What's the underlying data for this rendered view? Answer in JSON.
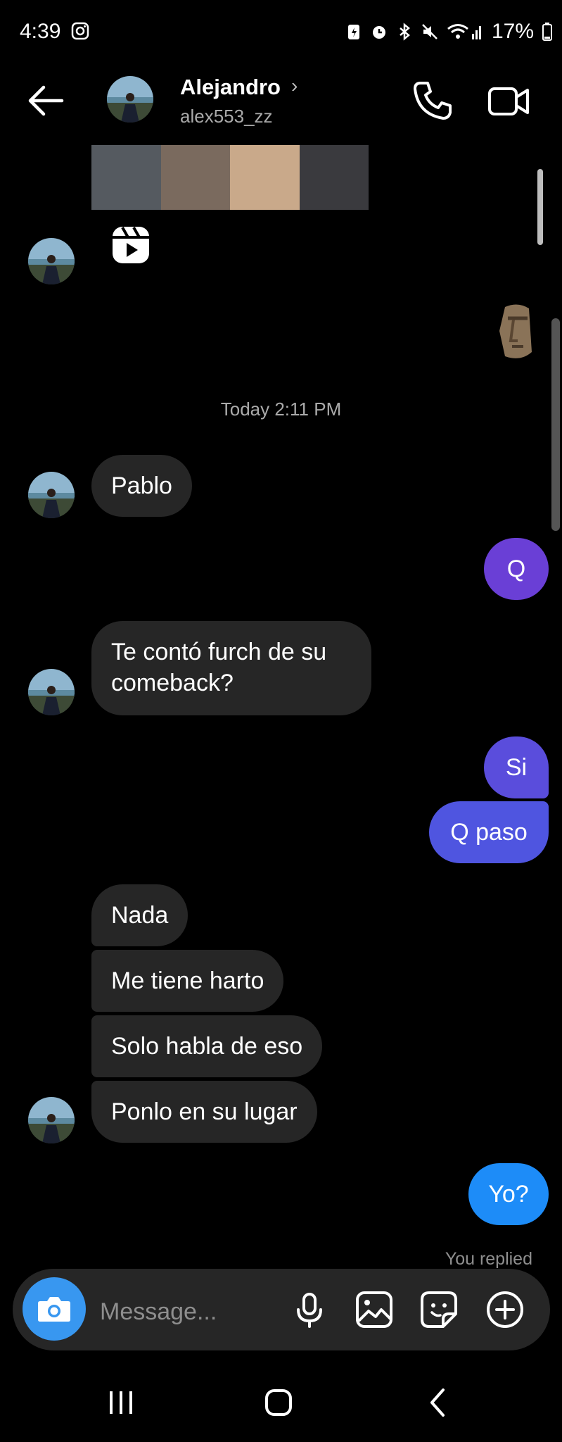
{
  "status_bar": {
    "time": "4:39",
    "battery": "17%"
  },
  "header": {
    "name": "Alejandro",
    "chevron": "›",
    "username": "alex553_zz"
  },
  "timestamp": "Today 2:11 PM",
  "messages": {
    "m1": "Pablo",
    "m2": "Q",
    "m3_line1": "Te contó furch de su",
    "m3_line2": "comeback?",
    "m4": "Si",
    "m5": "Q paso",
    "m6": "Nada",
    "m7": "Me tiene harto",
    "m8": "Solo habla de eso",
    "m9": "Ponlo en su lugar",
    "m10": "Yo?"
  },
  "you_replied": "You replied",
  "composer": {
    "placeholder": "Message..."
  },
  "colors": {
    "incoming_bubble": "#262626",
    "outgoing_purple": "#6a3fd6",
    "outgoing_indigo": "#4f55e0",
    "outgoing_blue": "#1d8cf8",
    "camera_accent": "#3897f0"
  },
  "icons": [
    "back-arrow-icon",
    "phone-icon",
    "video-camera-icon",
    "reel-icon",
    "moai-emoji",
    "camera-icon",
    "microphone-icon",
    "gallery-icon",
    "sticker-icon",
    "plus-circle-icon",
    "recents-icon",
    "home-icon",
    "nav-back-icon"
  ]
}
